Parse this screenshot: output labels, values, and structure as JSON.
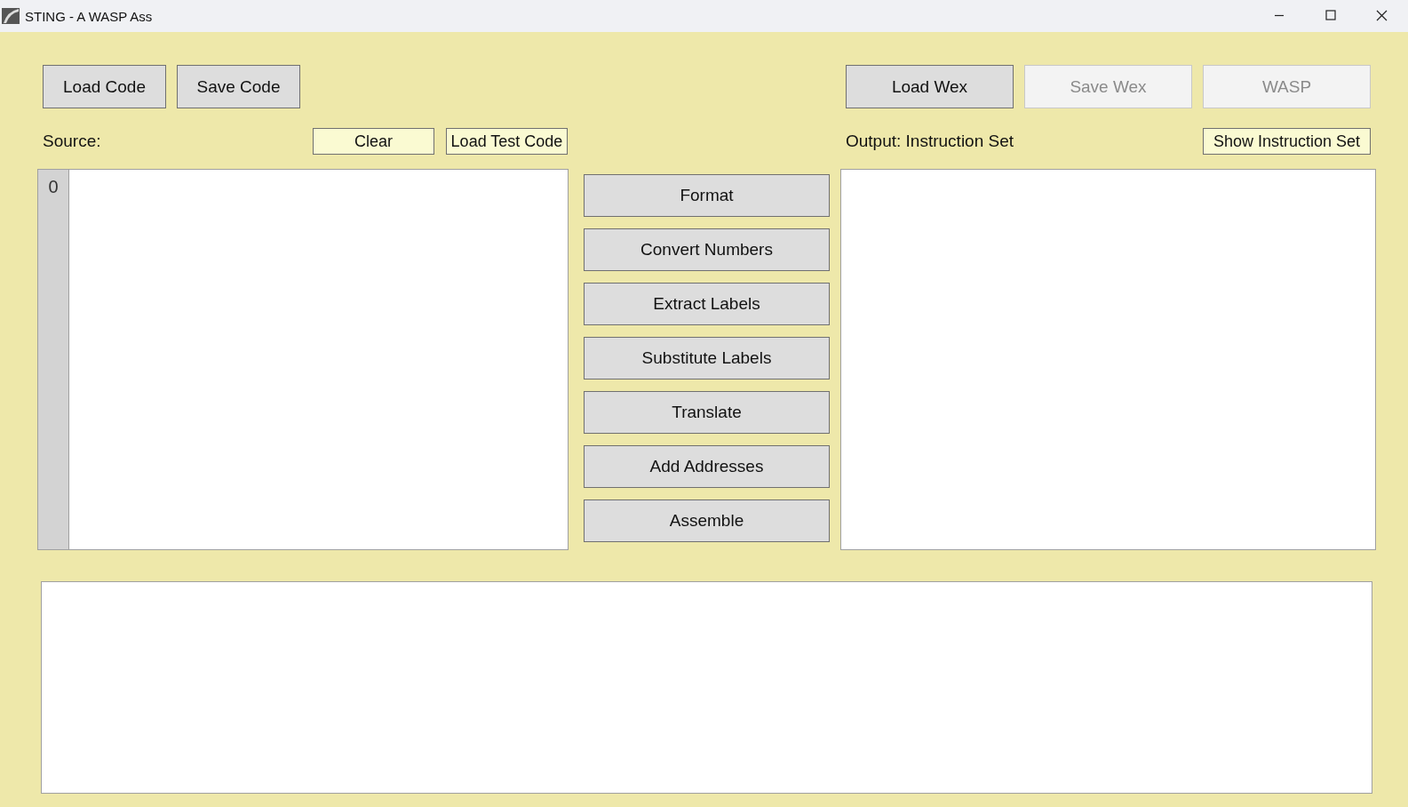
{
  "window": {
    "title": "STING - A WASP Ass"
  },
  "file_buttons": [
    {
      "label": "Load Code",
      "disabled": false
    },
    {
      "label": "Save Code",
      "disabled": false
    }
  ],
  "wex_buttons": [
    {
      "label": "Load Wex",
      "disabled": false
    },
    {
      "label": "Save Wex",
      "disabled": true
    },
    {
      "label": "WASP",
      "disabled": true
    }
  ],
  "source": {
    "label": "Source:",
    "buttons": [
      "Clear",
      "Load Test Code"
    ],
    "line_numbers": [
      "0"
    ]
  },
  "output": {
    "label": "Output: Instruction Set",
    "button": "Show Instruction Set"
  },
  "pipeline_buttons": [
    "Format",
    "Convert Numbers",
    "Extract Labels",
    "Substitute Labels",
    "Translate",
    "Add Addresses",
    "Assemble"
  ]
}
